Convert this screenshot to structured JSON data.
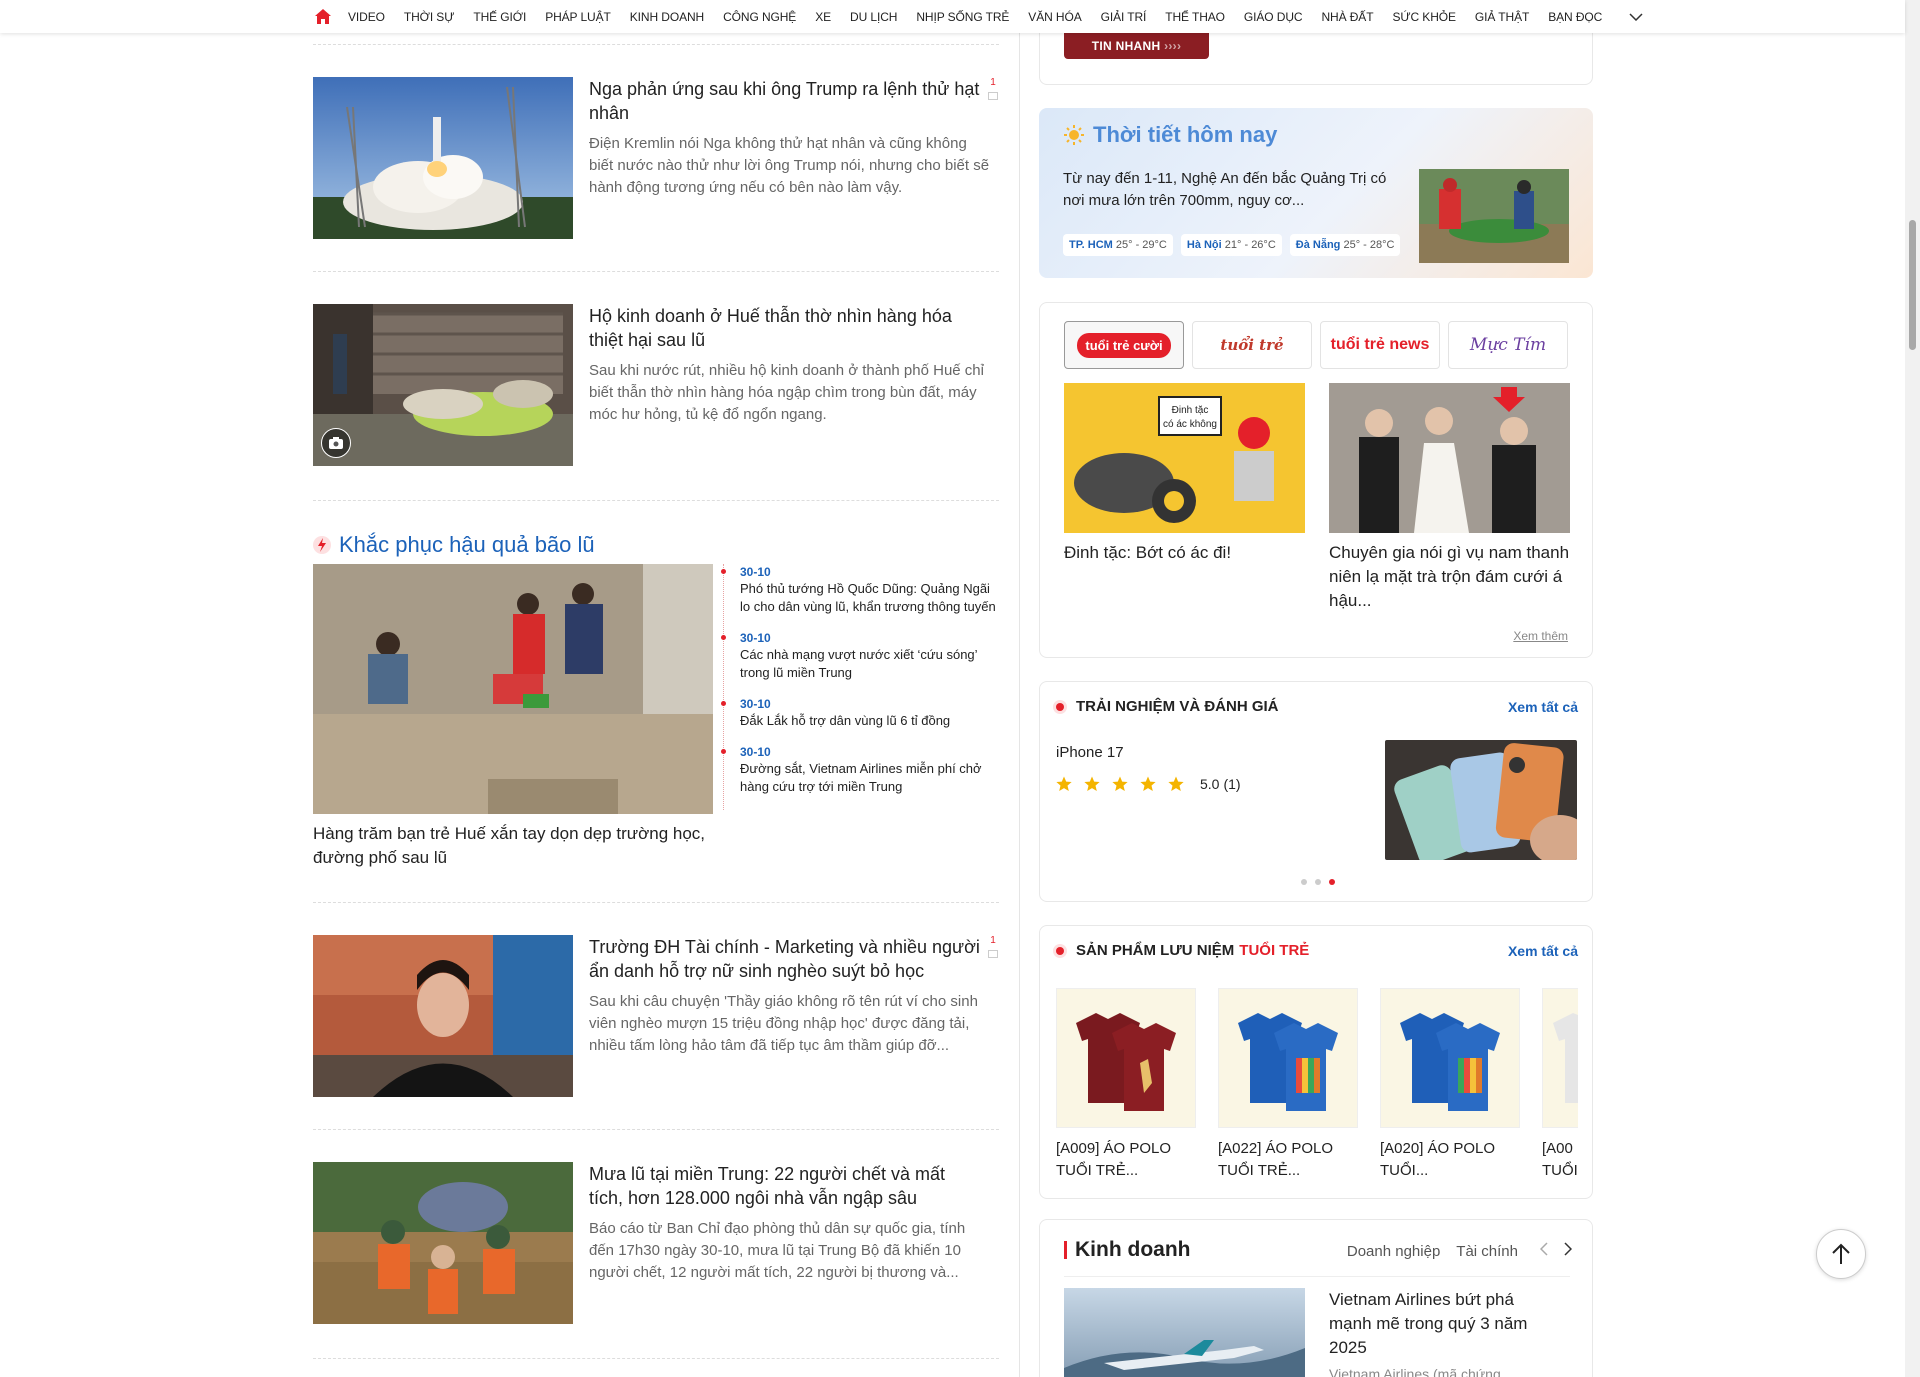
{
  "nav": {
    "items": [
      "VIDEO",
      "THỜI SỰ",
      "THẾ GIỚI",
      "PHÁP LUẬT",
      "KINH DOANH",
      "CÔNG NGHỆ",
      "XE",
      "DU LỊCH",
      "NHỊP SỐNG TRẺ",
      "VĂN HÓA",
      "GIẢI TRÍ",
      "THỂ THAO",
      "GIÁO DỤC",
      "NHÀ ĐẤT",
      "SỨC KHỎE",
      "GIẢ THẬT",
      "BẠN ĐỌC"
    ]
  },
  "articles": [
    {
      "title": "Nga phản ứng sau khi ông Trump ra lệnh thử hạt nhân",
      "desc": "Điện Kremlin nói Nga không thử hạt nhân và cũng không biết nước nào thử như lời ông Trump nói, nhưng cho biết sẽ hành động tương ứng nếu có bên nào làm vậy.",
      "comments": "1"
    },
    {
      "title": "Hộ kinh doanh ở Huế thẫn thờ nhìn hàng hóa thiệt hại sau lũ",
      "desc": "Sau khi nước rút, nhiều hộ kinh doanh ở thành phố Huế chỉ biết thẫn thờ nhìn hàng hóa ngập chìm trong bùn đất, máy móc hư hỏng, tủ kệ đổ ngổn ngang.",
      "comments": ""
    },
    {
      "title": "Trường ĐH Tài chính - Marketing và nhiều người ẩn danh hỗ trợ nữ sinh nghèo suýt bỏ học",
      "desc": "Sau khi câu chuyện 'Thầy giáo không rõ tên rút ví cho sinh viên nghèo mượn 15 triệu đồng nhập học' được đăng tải, nhiều tấm lòng hảo tâm đã tiếp tục âm thầm giúp đỡ...",
      "comments": "1"
    },
    {
      "title": "Mưa lũ tại miền Trung: 22 người chết và mất tích, hơn 128.000 ngôi nhà vẫn ngập sâu",
      "desc": "Báo cáo từ Ban Chỉ đạo phòng thủ dân sự quốc gia, tính đến 17h30 ngày 30-10, mưa lũ tại Trung Bộ đã khiến 10 người chết, 12 người mất tích, 22 người bị thương và...",
      "comments": ""
    }
  ],
  "topic": {
    "title": "Khắc phục hậu quả bão lũ",
    "main_title": "Hàng trăm bạn trẻ Huế xắn tay dọn dẹp trường học, đường phố sau lũ",
    "items": [
      {
        "date": "30-10",
        "title": "Phó thủ tướng Hồ Quốc Dũng: Quảng Ngãi lo cho dân vùng lũ, khẩn trương thông tuyến"
      },
      {
        "date": "30-10",
        "title": "Các nhà mạng vượt nước xiết ‘cứu sóng’ trong lũ miền Trung"
      },
      {
        "date": "30-10",
        "title": "Đắk Lắk hỗ trợ dân vùng lũ 6 tỉ đồng"
      },
      {
        "date": "30-10",
        "title": "Đường sắt, Vietnam Airlines miễn phí chở hàng cứu trợ tới miền Trung"
      }
    ]
  },
  "tinnhanh": "TIN NHANH",
  "weather": {
    "title": "Thời tiết hôm nay",
    "text": "Từ nay đến 1-11, Nghệ An đến bắc Quảng Trị có nơi mưa lớn trên 700mm, nguy cơ...",
    "cities": [
      {
        "name": "TP. HCM",
        "temp": "25° - 29°C"
      },
      {
        "name": "Hà Nội",
        "temp": "21° - 26°C"
      },
      {
        "name": "Đà Nẵng",
        "temp": "25° - 28°C"
      }
    ]
  },
  "brands": {
    "logos": [
      "tuổi trẻ cười",
      "tuổi trẻ",
      "tuổi trẻ news",
      "Mực Tím"
    ],
    "stories": [
      {
        "caption": "Đinh tặc: Bớt có ác đi!",
        "art_text_1": "Đinh tặc",
        "art_text_2": "có ác không"
      },
      {
        "caption": "Chuyên gia nói gì vụ nam thanh niên lạ mặt trà trộn đám cưới á hậu..."
      }
    ],
    "more": "Xem thêm"
  },
  "review": {
    "title": "TRẢI NGHIỆM VÀ ĐÁNH GIÁ",
    "see_all": "Xem tất cả",
    "product": "iPhone 17",
    "rating": 5,
    "score": "5.0",
    "count": "(1)"
  },
  "souvenir": {
    "title": "SẢN PHẨM LƯU NIỆM",
    "title_brand": "TUỔI TRẺ",
    "see_all": "Xem tất cả",
    "products": [
      {
        "name": "[A009] ÁO POLO TUỔI TRẺ..."
      },
      {
        "name": "[A022] ÁO POLO TUỔI TRẺ..."
      },
      {
        "name": "[A020] ÁO POLO TUỔI..."
      },
      {
        "name": "[A00 TUỔI"
      }
    ]
  },
  "business": {
    "title": "Kinh doanh",
    "tabs": [
      "Doanh nghiệp",
      "Tài chính"
    ],
    "headline": "Vietnam Airlines bứt phá mạnh mẽ trong quý 3 năm 2025",
    "desc": "Vietnam Airlines (mã chứng"
  }
}
